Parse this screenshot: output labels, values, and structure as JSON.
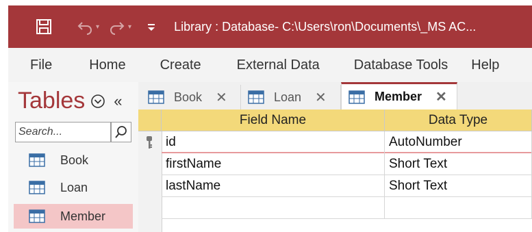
{
  "titlebar": {
    "title": "Library : Database- C:\\Users\\ron\\Documents\\_MS AC..."
  },
  "ribbon": {
    "tabs": [
      "File",
      "Home",
      "Create",
      "External Data",
      "Database Tools",
      "Help"
    ]
  },
  "navpane": {
    "title": "Tables",
    "collapse_glyph": "«",
    "search_placeholder": "Search...",
    "items": [
      {
        "label": "Book",
        "icon": "table-icon"
      },
      {
        "label": "Loan",
        "icon": "table-icon"
      },
      {
        "label": "Member",
        "icon": "table-icon",
        "selected": true
      }
    ]
  },
  "doctabs": [
    {
      "label": "Book",
      "close": "✕"
    },
    {
      "label": "Loan",
      "close": "✕"
    },
    {
      "label": "Member",
      "close": "✕",
      "active": true
    }
  ],
  "grid": {
    "columns": [
      "Field Name",
      "Data Type"
    ],
    "rows": [
      {
        "field": "id",
        "type": "AutoNumber",
        "primary_key": true
      },
      {
        "field": "firstName",
        "type": "Short Text"
      },
      {
        "field": "lastName",
        "type": "Short Text"
      }
    ]
  },
  "colors": {
    "accent": "#a4373a",
    "header": "#f3d97a",
    "selected_nav": "#f4c6c7"
  }
}
